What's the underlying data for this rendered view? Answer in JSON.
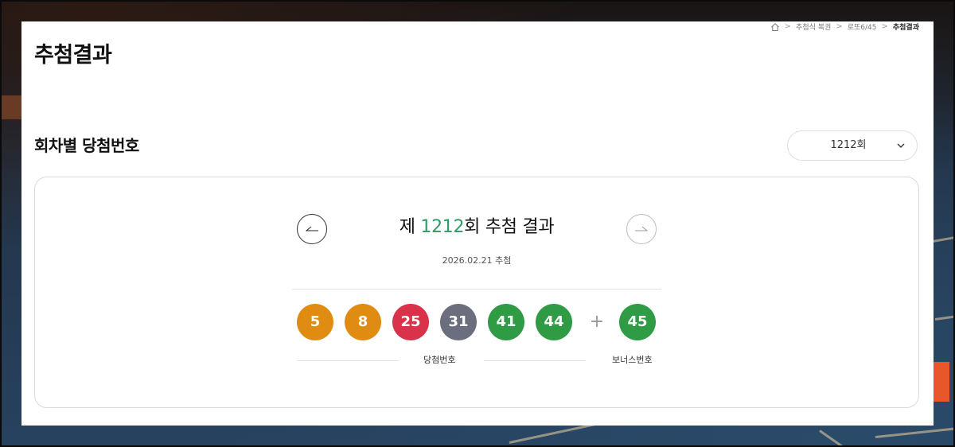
{
  "page": {
    "title": "추첨결과"
  },
  "breadcrumb": {
    "items": [
      "추첨식 복권",
      "로또6/45",
      "추첨결과"
    ],
    "separator": ">"
  },
  "section": {
    "title": "회차별 당첨번호"
  },
  "round_select": {
    "value": "1212회"
  },
  "result": {
    "title_prefix": "제 ",
    "round_number": "1212",
    "title_suffix": "회 추첨 결과",
    "date": "2026.02.21 추첨",
    "winning_numbers": [
      {
        "value": "5",
        "color": "#e08c12"
      },
      {
        "value": "8",
        "color": "#e08c12"
      },
      {
        "value": "25",
        "color": "#d8334a"
      },
      {
        "value": "31",
        "color": "#6b6f7d"
      },
      {
        "value": "41",
        "color": "#2f9b45"
      },
      {
        "value": "44",
        "color": "#2f9b45"
      }
    ],
    "plus_symbol": "+",
    "bonus_number": {
      "value": "45",
      "color": "#2f9b45"
    },
    "winning_label": "당첨번호",
    "bonus_label": "보너스번호"
  },
  "colors": {
    "accent_green": "#2f9b66"
  }
}
